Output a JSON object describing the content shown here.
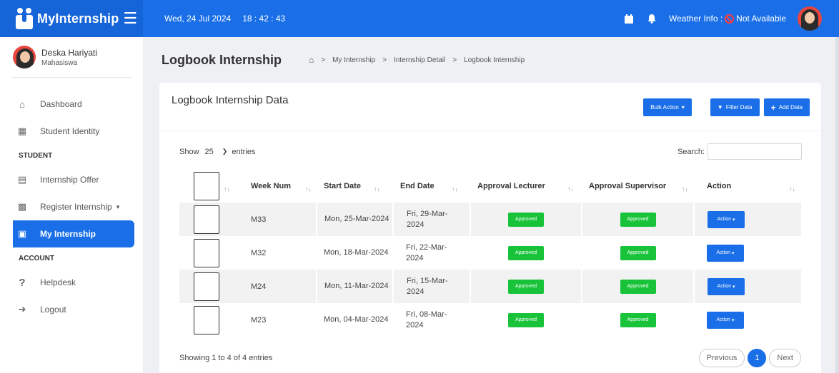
{
  "topbar": {
    "brand": "MyInternship",
    "menu_icon": "hamburger-icon",
    "date": "Wed, 24 Jul 2024",
    "time": "18 : 42 : 43",
    "weather_label": "Weather Info :",
    "weather_value": "Not Available",
    "color": "#1a6fe8"
  },
  "profile": {
    "name": "Deska Hariyati",
    "role": "Mahasiswa"
  },
  "sidebar": {
    "items": [
      {
        "label": "Dashboard",
        "icon": "home-icon"
      },
      {
        "label": "Student Identity",
        "icon": "id-card-icon"
      }
    ],
    "section_student": "STUDENT",
    "student_items": [
      {
        "label": "Internship Offer",
        "icon": "clipboard-icon"
      },
      {
        "label": "Register Internship",
        "icon": "form-icon"
      },
      {
        "label": "My Internship",
        "icon": "briefcase-icon"
      }
    ],
    "section_account": "ACCOUNT",
    "account_items": [
      {
        "label": "Helpdesk",
        "icon": "question-icon"
      },
      {
        "label": "Logout",
        "icon": "logout-icon"
      }
    ]
  },
  "header": {
    "title": "Logbook Internship",
    "breadcrumb": [
      "My Internship",
      "Internship Detail",
      "Logbook Internship"
    ]
  },
  "card": {
    "title": "Logbook Internship Data",
    "bulk_action": "Bulk Action",
    "filter": "Filter Data",
    "add": "Add Data"
  },
  "table_controls": {
    "show": "Show",
    "entries_value": "25",
    "entries": "entries",
    "search": "Search:"
  },
  "table": {
    "columns": [
      "Week Num",
      "Start Date",
      "End Date",
      "Approval Lecturer",
      "Approval Supervisor",
      "Action"
    ],
    "rows": [
      {
        "week": "M33",
        "start": "Mon, 25-Mar-2024",
        "end": "Fri, 29-Mar-2024",
        "lecturer": "Approved",
        "supervisor": "Approved",
        "action": "Action"
      },
      {
        "week": "M32",
        "start": "Mon, 18-Mar-2024",
        "end": "Fri, 22-Mar-2024",
        "lecturer": "Approved",
        "supervisor": "Approved",
        "action": "Action"
      },
      {
        "week": "M24",
        "start": "Mon, 11-Mar-2024",
        "end": "Fri, 15-Mar-2024",
        "lecturer": "Approved",
        "supervisor": "Approved",
        "action": "Action"
      },
      {
        "week": "M23",
        "start": "Mon, 04-Mar-2024",
        "end": "Fri, 08-Mar-2024",
        "lecturer": "Approved",
        "supervisor": "Approved",
        "action": "Action"
      }
    ]
  },
  "footer": {
    "info": "Showing 1 to 4 of 4 entries",
    "previous": "Previous",
    "page": "1",
    "next": "Next"
  }
}
